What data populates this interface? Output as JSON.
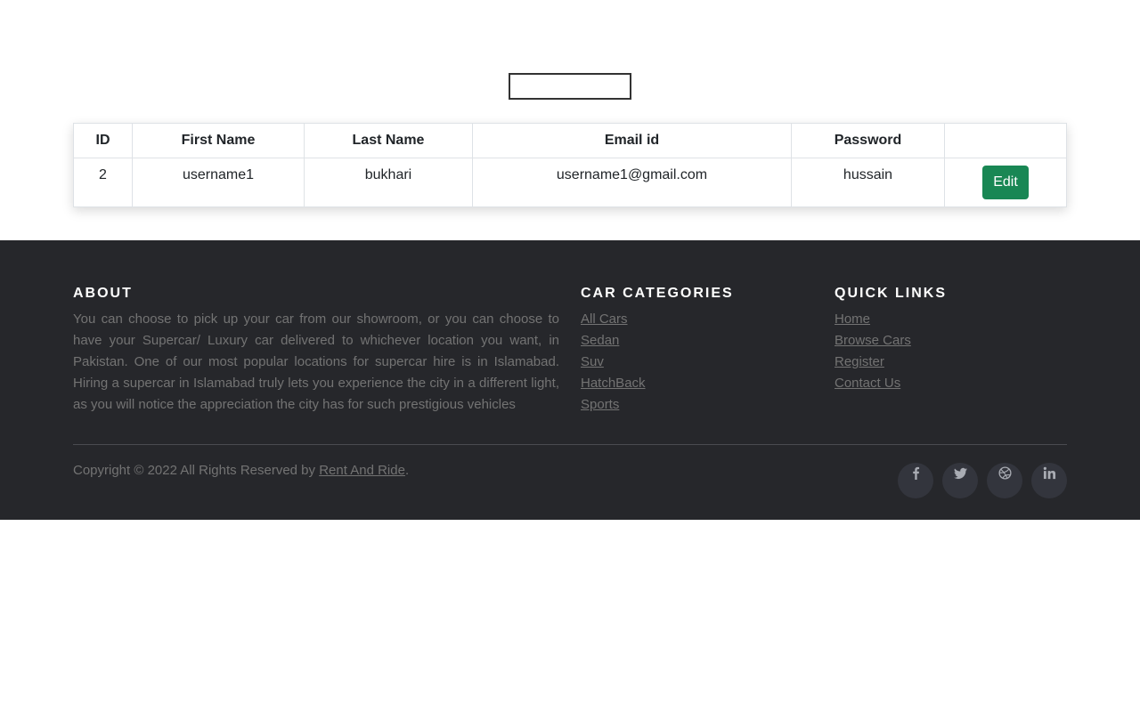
{
  "search": {
    "value": "",
    "placeholder": ""
  },
  "table": {
    "headers": [
      "ID",
      "First Name",
      "Last Name",
      "Email id",
      "Password",
      ""
    ],
    "rows": [
      {
        "id": "2",
        "first_name": "username1",
        "last_name": "bukhari",
        "email": "username1@gmail.com",
        "password": "hussain",
        "action_label": "Edit"
      }
    ]
  },
  "footer": {
    "about": {
      "title": "ABOUT",
      "text": "You can choose to pick up your car from our showroom, or you can choose to have your Supercar/ Luxury car delivered to whichever location you want, in Pakistan. One of our most popular locations for supercar hire is in Islamabad. Hiring a supercar in Islamabad truly lets you experience the city in a different light, as you will notice the appreciation the city has for such prestigious vehicles"
    },
    "categories": {
      "title": "CAR CATEGORIES",
      "items": [
        "All Cars",
        "Sedan",
        "Suv",
        "HatchBack",
        "Sports"
      ]
    },
    "quick_links": {
      "title": "QUICK LINKS",
      "items": [
        "Home",
        "Browse Cars",
        "Register",
        "Contact Us"
      ]
    },
    "copyright_prefix": "Copyright © 2022 All Rights Reserved by ",
    "copyright_link": "Rent And Ride",
    "copyright_suffix": ".",
    "social": [
      "facebook-icon",
      "twitter-icon",
      "dribbble-icon",
      "linkedin-icon"
    ]
  },
  "colors": {
    "edit_button": "#198754",
    "footer_bg": "#26272b",
    "footer_text": "#737373",
    "social_bg": "#33353d"
  }
}
